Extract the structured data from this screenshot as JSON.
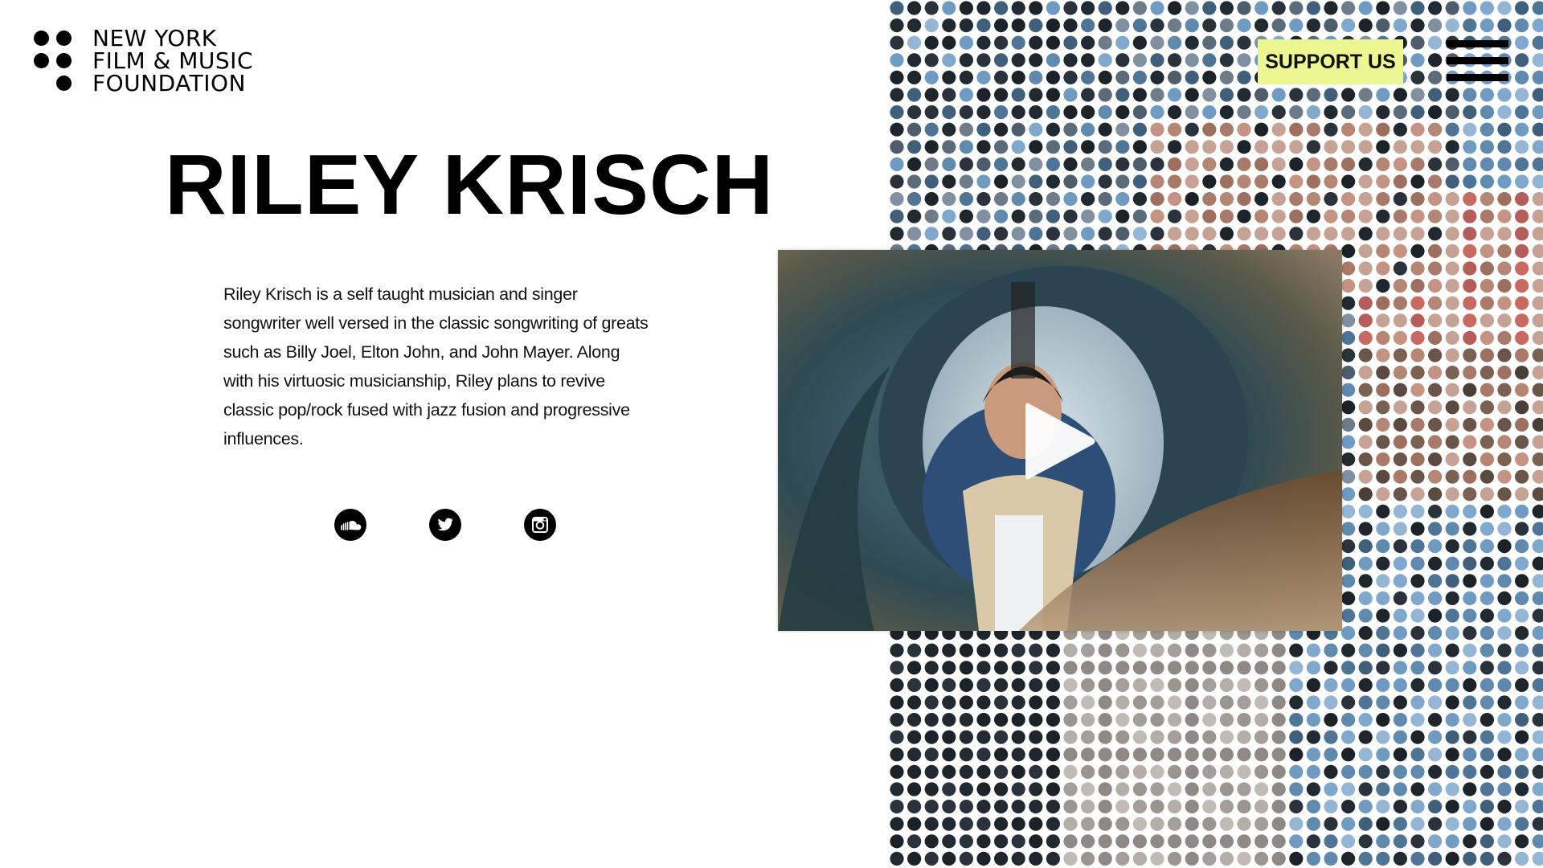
{
  "logo": {
    "lines": [
      "NEW YORK",
      "FILM & MUSIC",
      "FOUNDATION"
    ]
  },
  "header": {
    "support_label": "SUPPORT US",
    "menu_icon": "hamburger-menu-icon"
  },
  "artist": {
    "name": "RILEY KRISCH",
    "bio": "Riley Krisch is a self taught musician and singer songwriter well versed in the classic songwriting of greats such as Billy Joel, Elton John, and John Mayer. Along with his virtuosic musicianship, Riley plans to revive classic pop/rock fused with jazz fusion and progressive influences."
  },
  "social": [
    {
      "name": "soundcloud",
      "icon": "soundcloud-icon"
    },
    {
      "name": "twitter",
      "icon": "twitter-bird-icon"
    },
    {
      "name": "instagram",
      "icon": "instagram-camera-icon"
    }
  ],
  "video": {
    "icon": "play-icon"
  },
  "colors": {
    "accent": "#ecf792",
    "text": "#000000",
    "background": "#ffffff"
  }
}
